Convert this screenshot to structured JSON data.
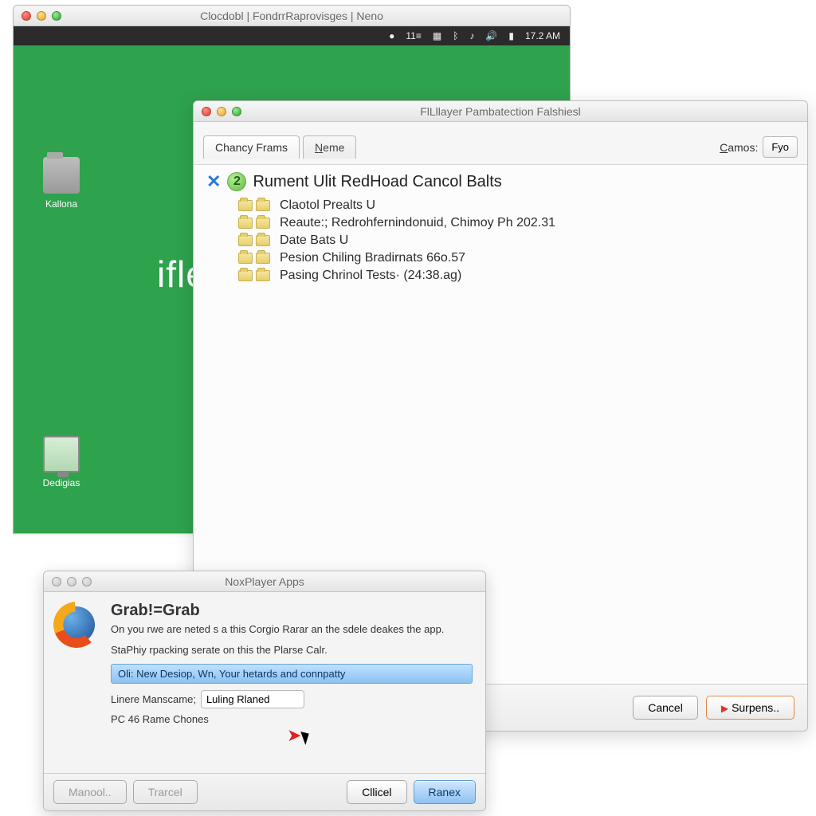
{
  "main_window": {
    "title": "Clocdobl | FondrrRaprovisges | Neno",
    "menubar": {
      "label": "11≡",
      "clock": "17.2 AM"
    },
    "brand": "iflea",
    "icons": [
      {
        "name": "kallona",
        "label": "Kallona"
      },
      {
        "name": "dedigias",
        "label": "Dedigias"
      }
    ]
  },
  "file_dialog": {
    "title": "FlLllayer Pambatection Falshiesl",
    "tabs": [
      {
        "label": "Chancy Frams"
      },
      {
        "label_u": "N",
        "label_rest": "eme"
      }
    ],
    "right_label_u": "C",
    "right_label_rest": "amos:",
    "right_btn": "Fyo",
    "heading_num": "2",
    "heading": "Rument Ulit RedHoad Cancol Balts",
    "rows": [
      "Claotol Prealts U",
      "Reaute:; Redrohfernindonuid, Chimoy Ph 202.31",
      "Date Bats U",
      "Pesion Chiling Bradirnats 66o.57",
      "Pasing Chrinol Tests· (24:38.ag)"
    ],
    "footer": {
      "cancel": "Cancel",
      "confirm": "Surpens.."
    }
  },
  "nox": {
    "title": "NoxPlayer Apps",
    "heading": "Grab!=Grab",
    "p1": "On you rwe are neted s a this Corgio Rarar an the sdele deakes the app.",
    "p2": "StaPhiy rpacking serate on this the Plarse Calr.",
    "selected": "Oli: New Desiop, Wn, Your hetards and connpatty",
    "field_label": "Linere Manscame;",
    "field_value": "Luling Rlaned",
    "footnote": "PC 46 Rame Chones",
    "buttons": {
      "b1": "Manool..",
      "b2": "Trarcel",
      "b3": "Cllicel",
      "b4": "Ranex"
    }
  }
}
